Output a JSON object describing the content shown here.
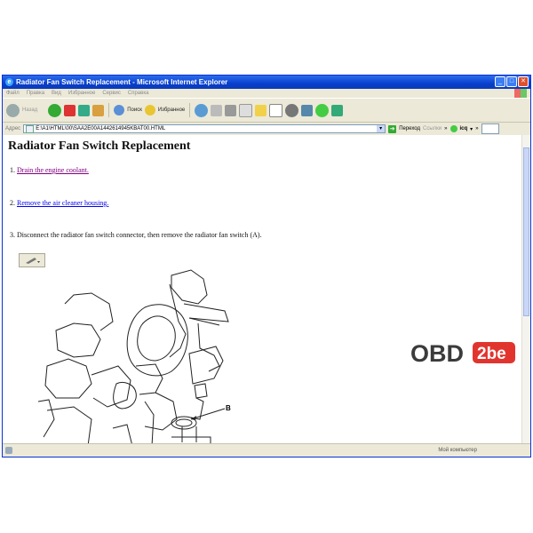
{
  "window": {
    "title": "Radiator Fan Switch Replacement - Microsoft Internet Explorer"
  },
  "menu": [
    "Файл",
    "Правка",
    "Вид",
    "Избранное",
    "Сервис",
    "Справка"
  ],
  "toolbar": {
    "back": "Назад",
    "search": "Поиск",
    "favorites": "Избранное"
  },
  "address": {
    "label": "Адрес",
    "value": "E:\\A1\\HTML\\00\\SAA2E00A1442614945KBAT00.HTML",
    "go": "Переход",
    "links": "Ссылки",
    "icq": "icq"
  },
  "page": {
    "heading": "Radiator Fan Switch Replacement",
    "steps": [
      {
        "num": "1.",
        "link": "Drain the engine coolant."
      },
      {
        "num": "2.",
        "link": "Remove the air cleaner housing."
      },
      {
        "num": "3.",
        "text": "Disconnect the radiator fan switch connector, then remove the radiator fan switch (A)."
      }
    ],
    "figure_label": "B"
  },
  "status": {
    "zone": "Мой компьютер"
  },
  "watermark": {
    "text": "OBD",
    "badge": "2be"
  },
  "colors": {
    "titlebar": "#0a3fcc",
    "visited": "#800080",
    "link": "#0000ee"
  }
}
